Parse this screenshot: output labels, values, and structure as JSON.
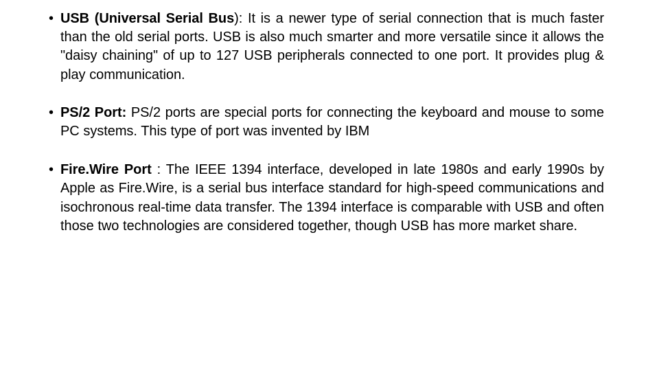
{
  "slide": {
    "background_color": "#ffffff",
    "text_color": "#000000",
    "bullet_glyph": "•"
  },
  "bullets": [
    {
      "id": "usb",
      "marker": "•",
      "lead": "USB (Universal Serial Bus",
      "body": "): It is a newer type of serial connection that is much faster than the old serial ports. USB is also much smarter and more versatile since it allows the \"daisy chaining\" of up to 127 USB peripherals connected to one port. It provides plug & play communication."
    },
    {
      "id": "ps2",
      "marker": "•",
      "lead": "PS/2 Port:",
      "body": " PS/2 ports are special ports for connecting the keyboard and mouse to some PC systems. This type of port was invented by IBM"
    },
    {
      "id": "firewire",
      "marker": "•",
      "lead": "Fire.Wire Port",
      "body": " : The IEEE 1394 interface, developed in late 1980s and early 1990s by Apple as Fire.Wire, is a serial bus interface standard for high-speed communications and isochronous real-time data transfer. The 1394 interface is comparable with USB and often those two technologies are considered together, though USB has more market share."
    }
  ]
}
